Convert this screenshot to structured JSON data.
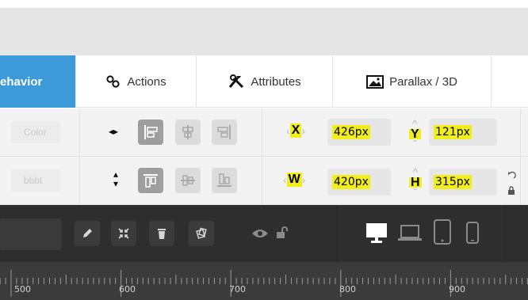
{
  "tabs": [
    {
      "label": "ehavior",
      "active": true
    },
    {
      "label": "Actions",
      "icon": "link-icon"
    },
    {
      "label": "Attributes",
      "icon": "tools-icon"
    },
    {
      "label": "Parallax / 3D",
      "icon": "image-icon"
    }
  ],
  "row1": {
    "ghost_label": "Color",
    "x_label": "X",
    "x_value": "426px",
    "y_label": "Y",
    "y_value": "121px"
  },
  "row2": {
    "ghost_label": "bbbt",
    "w_label": "W",
    "w_value": "420px",
    "h_label": "H",
    "h_value": "315px"
  },
  "ruler": {
    "labels": [
      "500",
      "600",
      "700",
      "800",
      "900"
    ]
  },
  "colors": {
    "active_tab": "#3d9ad9",
    "highlight": "#f2ee1a",
    "dark_toolbar": "#2e2e2e",
    "ruler": "#3b3b3b"
  }
}
